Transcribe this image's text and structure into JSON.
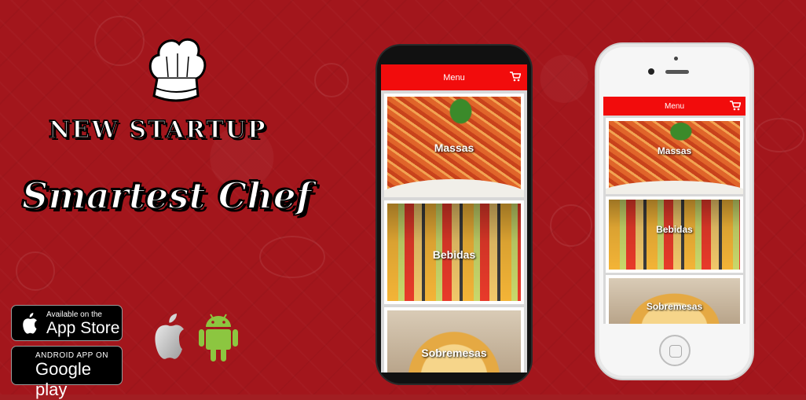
{
  "branding": {
    "tagline": "NEW STARTUP",
    "app_name": "Smartest Chef"
  },
  "badges": {
    "app_store": {
      "small": "Available on the",
      "big": "App Store"
    },
    "google_play": {
      "small": "ANDROID APP ON",
      "big": "Google play"
    }
  },
  "platform_icons": [
    "apple-icon",
    "android-icon"
  ],
  "app_screen": {
    "title": "Menu",
    "cart_icon": "cart-icon",
    "items": [
      {
        "label": "Massas"
      },
      {
        "label": "Bebidas"
      },
      {
        "label": "Sobremesas"
      }
    ]
  },
  "colors": {
    "background": "#a3161c",
    "appbar": "#f20c0c",
    "android_green": "#8cc640"
  }
}
